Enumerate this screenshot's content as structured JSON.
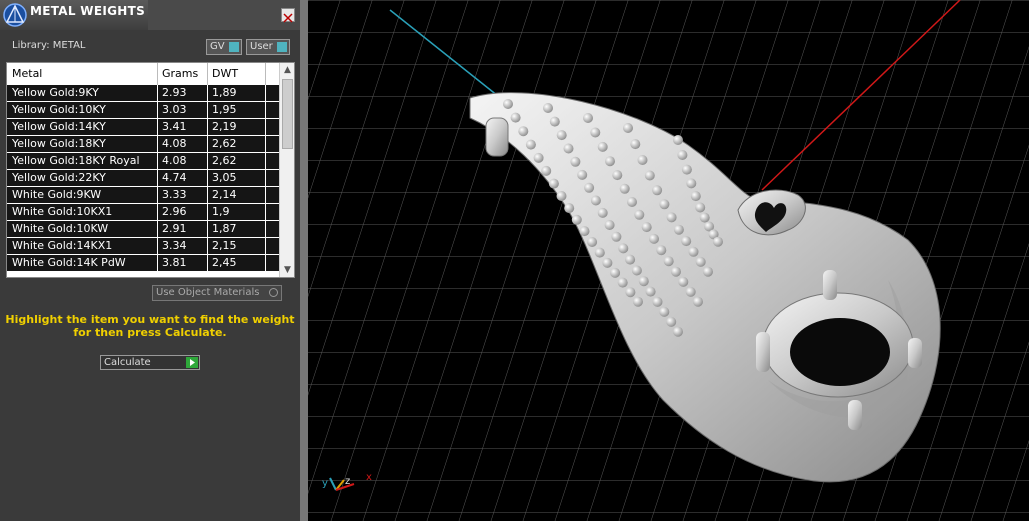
{
  "panel": {
    "title": "METAL WEIGHTS",
    "library_label": "Library: METAL",
    "toggle_gv": "GV",
    "toggle_user": "User",
    "columns": [
      "Metal",
      "Grams",
      "DWT"
    ],
    "rows": [
      {
        "metal": "Yellow Gold:9KY",
        "grams": "2.93",
        "dwt": "1,89"
      },
      {
        "metal": "Yellow Gold:10KY",
        "grams": "3.03",
        "dwt": "1,95"
      },
      {
        "metal": "Yellow Gold:14KY",
        "grams": "3.41",
        "dwt": "2,19"
      },
      {
        "metal": "Yellow Gold:18KY",
        "grams": "4.08",
        "dwt": "2,62"
      },
      {
        "metal": "Yellow Gold:18KY Royal",
        "grams": "4.08",
        "dwt": "2,62"
      },
      {
        "metal": "Yellow Gold:22KY",
        "grams": "4.74",
        "dwt": "3,05"
      },
      {
        "metal": "White Gold:9KW",
        "grams": "3.33",
        "dwt": "2,14"
      },
      {
        "metal": "White Gold:10KX1",
        "grams": "2.96",
        "dwt": "1,9"
      },
      {
        "metal": "White Gold:10KW",
        "grams": "2.91",
        "dwt": "1,87"
      },
      {
        "metal": "White Gold:14KX1",
        "grams": "3.34",
        "dwt": "2,15"
      },
      {
        "metal": "White Gold:14K PdW",
        "grams": "3.81",
        "dwt": "2,45"
      }
    ],
    "use_object_materials": "Use Object Materials",
    "instruction": "Highlight the item you want to find the weight for then press Calculate.",
    "calculate_label": "Calculate"
  },
  "viewport": {
    "axis_labels": {
      "y": "y",
      "z": "z",
      "x": "x"
    },
    "colors": {
      "x_axis": "#d01818",
      "y_axis": "#2aa0b8",
      "grid": "#5a5a5a"
    }
  },
  "colors": {
    "accent_yellow": "#f0d000",
    "calc_green": "#2ea83a",
    "toggle_teal": "#4fb3bf"
  }
}
